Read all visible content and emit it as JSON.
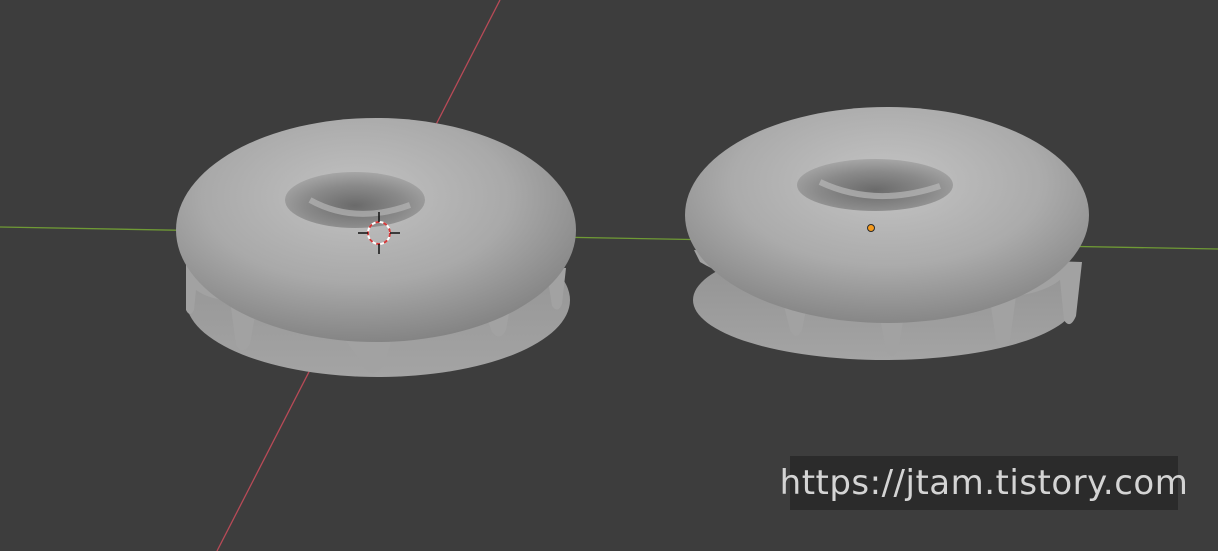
{
  "viewport": {
    "background": "#3d3d3d",
    "x_axis_color": "#6f9a35",
    "y_axis_color": "#b84a57",
    "mesh_color": "#a8a8a8"
  },
  "scene": {
    "objects": [
      {
        "name": "donut-left",
        "icon": "3d-cursor-icon"
      },
      {
        "name": "donut-right",
        "icon": "object-origin-icon",
        "origin_color": "#f59a1c"
      }
    ]
  },
  "watermark": {
    "text": "https://jtam.tistory.com"
  }
}
